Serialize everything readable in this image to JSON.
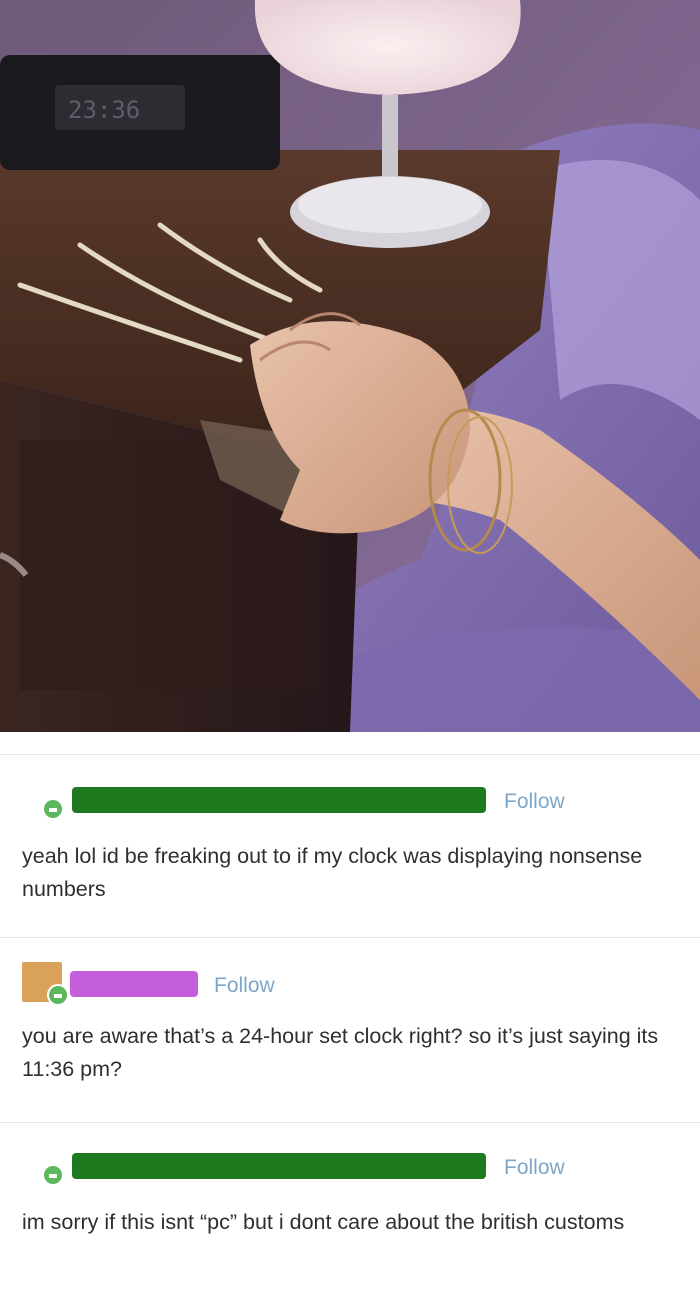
{
  "photo": {
    "clock_display": "23:36"
  },
  "posts": [
    {
      "follow_label": "Follow",
      "text": "yeah lol id be freaking out to if my clock was displaying nonsense numbers",
      "redaction_color": "#1e7a1e"
    },
    {
      "follow_label": "Follow",
      "text": "you are aware that’s a 24-hour set clock right? so it’s just saying its 11:36 pm?",
      "redaction_color": "#c45fdc"
    },
    {
      "follow_label": "Follow",
      "text": "im sorry if this isnt “pc” but i dont care about the british customs",
      "redaction_color": "#1e7a1e"
    }
  ],
  "colors": {
    "follow": "#7ea6c9",
    "avatar_green": "#5cb85c"
  }
}
